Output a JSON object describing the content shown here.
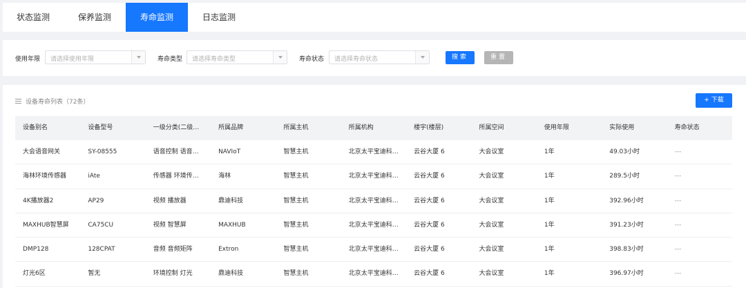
{
  "tabs": [
    {
      "label": "状态监测",
      "active": false
    },
    {
      "label": "保养监测",
      "active": false
    },
    {
      "label": "寿命监测",
      "active": true
    },
    {
      "label": "日志监测",
      "active": false
    }
  ],
  "filters": {
    "usage_years": {
      "label": "使用年限",
      "placeholder": "请选择使用年限"
    },
    "life_type": {
      "label": "寿命类型",
      "placeholder": "请选择寿命类型"
    },
    "life_status": {
      "label": "寿命状态",
      "placeholder": "请选择寿命状态"
    },
    "search_label": "搜索",
    "reset_label": "重置"
  },
  "list": {
    "title": "设备寿命列表（72条）",
    "download_label": "+ 下载"
  },
  "table": {
    "headers": [
      "设备别名",
      "设备型号",
      "一级分类(二级…",
      "所属品牌",
      "所属主机",
      "所属机构",
      "楼宇(楼层)",
      "所属空间",
      "使用年限",
      "实际使用",
      "寿命状态"
    ],
    "rows": [
      [
        "大会语音网关",
        "SY-08555",
        "语音控制 语音…",
        "NAVIoT",
        "智慧主机",
        "北京太平宝迪科…",
        "云谷大厦 6",
        "大会议室",
        "1年",
        "49.03小时",
        "---"
      ],
      [
        "海林环境传感器",
        "iAte",
        "传感器 环境传…",
        "海林",
        "智慧主机",
        "北京太平宝迪科…",
        "云谷大厦 6",
        "大会议室",
        "1年",
        "289.5小时",
        "---"
      ],
      [
        "4K播放器2",
        "AP29",
        "视频 播放器",
        "鼎迪科技",
        "智慧主机",
        "北京太平宝迪科…",
        "云谷大厦 6",
        "大会议室",
        "1年",
        "392.96小时",
        "---"
      ],
      [
        "MAXHUB智慧屏",
        "CA75CU",
        "视频 智慧屏",
        "MAXHUB",
        "智慧主机",
        "北京太平宝迪科…",
        "云谷大厦 6",
        "大会议室",
        "1年",
        "391.23小时",
        "---"
      ],
      [
        "DMP128",
        "128CPAT",
        "音频 音频矩阵",
        "Extron",
        "智慧主机",
        "北京太平宝迪科…",
        "云谷大厦 6",
        "大会议室",
        "1年",
        "398.83小时",
        "---"
      ],
      [
        "灯光6区",
        "暂无",
        "环境控制 灯光",
        "鼎迪科技",
        "智慧主机",
        "北京太平宝迪科…",
        "云谷大厦 6",
        "大会议室",
        "1年",
        "396.97小时",
        "---"
      ]
    ]
  },
  "colors": {
    "accent": "#1677ff",
    "reset": "#b5b5b5",
    "page_bg": "#f0f2f5"
  }
}
